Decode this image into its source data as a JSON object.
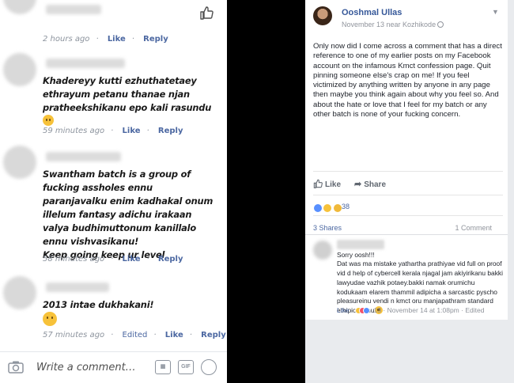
{
  "left_panel": {
    "comments": [
      {
        "text": "",
        "time": "2 hours ago",
        "like": "Like",
        "reply": "Reply"
      },
      {
        "text": "Khadereyy kutti ezhuthatetaey ethrayum petanu thanae njan pratheekshikanu epo kali rasundu",
        "time": "59 minutes ago",
        "like": "Like",
        "reply": "Reply"
      },
      {
        "text": "Swantham batch is a group of fucking assholes ennu paranjavalku enim kadhakal onum illelum fantasy adichu irakaan valya budhimuttonum kanillalo ennu vishvasikanu!\nKeep going keep ur level",
        "time": "58 minutes ago",
        "like": "Like",
        "reply": "Reply"
      },
      {
        "text": "2013 intae dukhakani!",
        "time": "57 minutes ago",
        "edited": "Edited",
        "like": "Like",
        "reply": "Reply"
      }
    ],
    "compose": {
      "placeholder": "Write a comment…",
      "gif_label": "GIF"
    }
  },
  "post": {
    "author": "Ooshmal Ullas",
    "date": "November 13 near Kozhikode",
    "body": "Only now did I come across a comment that has a direct reference to one of my earlier posts on my Facebook account on the infamous Kmct confession page. Quit pinning someone else's crap on me! If you feel victimized by anything written by anyone in any page then maybe you think again about why you feel so. And about the hate or love that I feel for my batch or any other batch is none of your fucking concern.",
    "like_label": "Like",
    "share_label": "Share",
    "reaction_count": "38",
    "shares": "3 Shares",
    "comments_count": "1 Comment",
    "comment": {
      "text": "Sorry oosh!!!\nDat was ma mistake yathartha prathiyae vid full on proof vid d help of cybercell kerala njagal jam akiyirikanu bakki lawyudae vazhik potaey.bakki namak orumichu kodukaam elarem thammil adipicha a sarcastic pyscho pleasureinu vendi n kmct oru manjapathram standard ethipichaenu",
      "like": "Like",
      "reactions": "13",
      "date": "November 14 at 1:08pm",
      "edited": "Edited"
    }
  },
  "colors": {
    "link_blue": "#4b67a1",
    "fb_name_blue": "#365899",
    "meta_gray": "#8d949e",
    "background_black": "#000000",
    "fb_gray_bg": "#e9ebee"
  }
}
